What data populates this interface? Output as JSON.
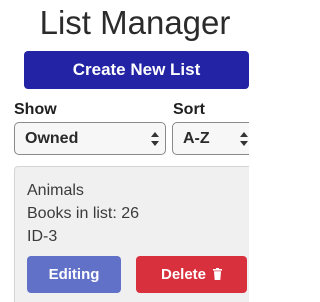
{
  "app": {
    "title": "List Manager"
  },
  "toolbar": {
    "create_label": "Create New List"
  },
  "filters": {
    "show": {
      "label": "Show",
      "selected": "Owned"
    },
    "sort": {
      "label": "Sort",
      "selected": "A-Z"
    }
  },
  "lists": [
    {
      "name": "Animals",
      "books_text": "Books in list: 26",
      "id_text": "ID-3",
      "edit_label": "Editing",
      "delete_label": "Delete",
      "delete_icon": "trash-icon"
    }
  ],
  "colors": {
    "primary": "#2323a6",
    "editing": "#6271c8",
    "danger": "#d9303e"
  }
}
